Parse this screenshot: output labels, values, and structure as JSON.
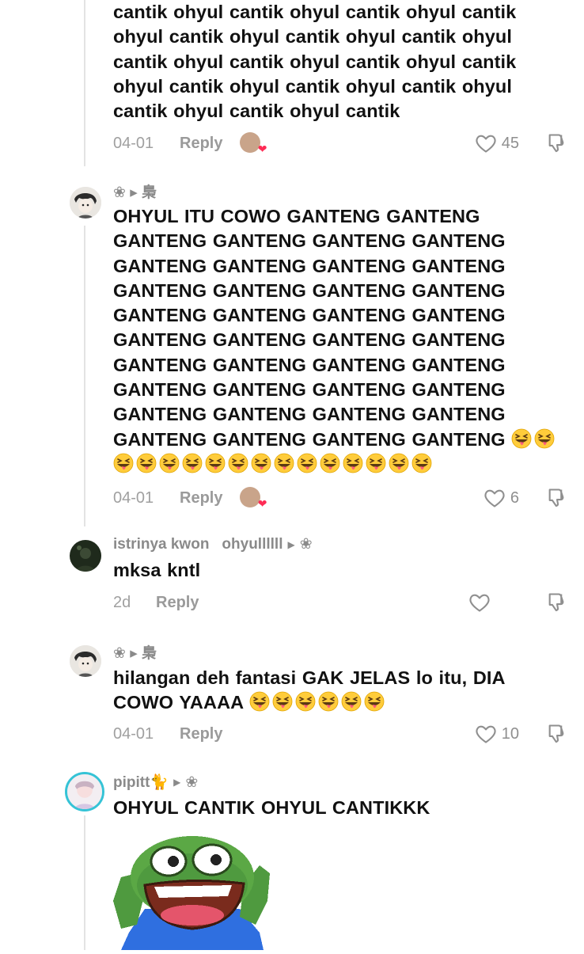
{
  "comments": [
    {
      "text": "cantik ohyul cantik ohyul cantik ohyul cantik ohyul cantik ohyul cantik ohyul cantik ohyul cantik ohyul cantik ohyul cantik ohyul cantik ohyul cantik ohyul cantik ohyul cantik ohyul cantik ohyul cantik ohyul cantik",
      "date": "04-01",
      "reply_label": "Reply",
      "likes": "45"
    },
    {
      "username": "❀ ▸ 梟",
      "text": "OHYUL ITU COWO GANTENG GANTENG GANTENG GANTENG GANTENG GANTENG GANTENG GANTENG GANTENG GANTENG GANTENG GANTENG GANTENG GANTENG GANTENG GANTENG GANTENG GANTENG GANTENG GANTENG GANTENG GANTENG GANTENG GANTENG GANTENG GANTENG GANTENG GANTENG GANTENG GANTENG GANTENG GANTENG GANTENG GANTENG GANTENG GANTENG GANTENG GANTENG",
      "emoji_count": 16,
      "date": "04-01",
      "reply_label": "Reply",
      "likes": "6"
    },
    {
      "username": "istrinya kwon",
      "reply_to": "ohyullllll",
      "reply_to_tag": "❀",
      "text": "mksa kntl",
      "date": "2d",
      "reply_label": "Reply"
    },
    {
      "username": "❀ ▸ 梟",
      "text": "hilangan deh fantasi GAK JELAS lo itu, DIA COWO YAAAA",
      "emoji_count": 6,
      "date": "04-01",
      "reply_label": "Reply",
      "likes": "10"
    },
    {
      "username": "pipitt🐈",
      "reply_to_tag": "❀",
      "text": "OHYUL CANTIK OHYUL CANTIKKK"
    }
  ],
  "icons": {
    "like": "heart-outline-icon",
    "dislike": "thumbs-down-icon",
    "emoji": "squinting-tongue-emoji",
    "sticker": "pepe-frog-sticker"
  },
  "colors": {
    "muted": "#8a8a8a",
    "heart": "#fe2c55",
    "text": "#111111"
  }
}
